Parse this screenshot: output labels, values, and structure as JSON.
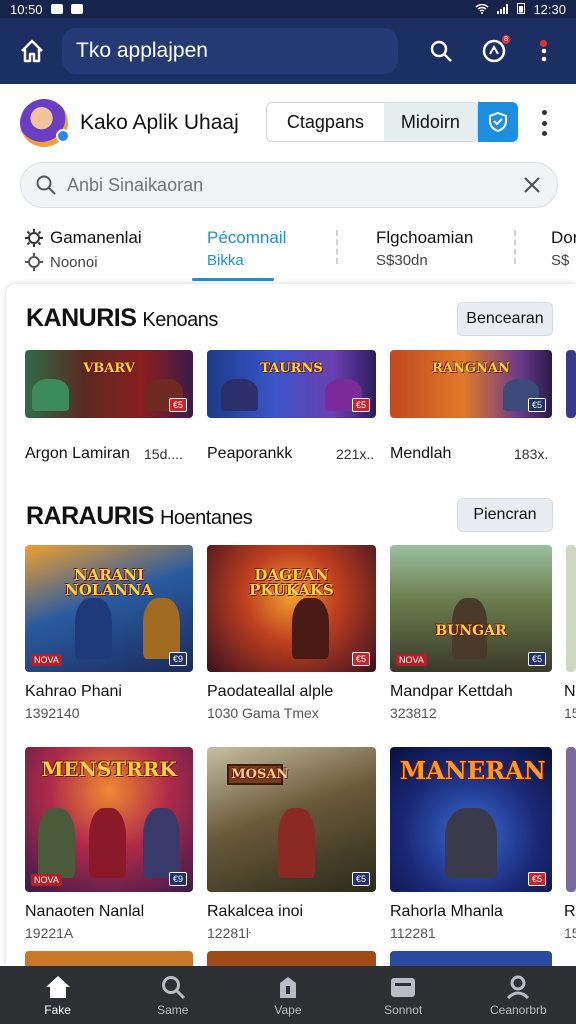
{
  "status": {
    "time_left": "10:50",
    "time_right": "12:30"
  },
  "appbar": {
    "title": "Tko applajpen",
    "notif_badge": "8"
  },
  "profile": {
    "name": "Kako Aplik Uhaaj",
    "seg_left": "Ctagpans",
    "seg_right": "Midoirn"
  },
  "search": {
    "placeholder": "Anbi Sinaikaoran"
  },
  "tabs": [
    {
      "line1": "Gamanenlai",
      "line2": "Noonoi"
    },
    {
      "line1": "Pécomnail",
      "line2": "Bikka"
    },
    {
      "line1": "Flgchoamian",
      "line2": "S$30dn"
    },
    {
      "line1": "Dor",
      "line2": "S$"
    }
  ],
  "section1": {
    "title": "KANURIS",
    "subtitle": "Kenoans",
    "button": "Bencearan",
    "items": [
      {
        "logo": "VBARV",
        "title": "Argon Lamiran",
        "value": "15d....",
        "tag": "€5"
      },
      {
        "logo": "TAURNS",
        "title": "Peaporankk",
        "value": "221x..",
        "tag": "€5"
      },
      {
        "logo": "RANGNAN",
        "title": "Mendlah",
        "value": "183x.",
        "tag": "€5"
      }
    ]
  },
  "section2": {
    "title": "RARAURIS",
    "subtitle": "Hoentanes",
    "button": "Piencran",
    "items": [
      {
        "logo": "NARANI NOLANNA",
        "title": "Kahrao Phani",
        "sub": "1392140",
        "tag": "€9"
      },
      {
        "logo": "DAGEAN PKUKAKS",
        "title": "Paodateallal alple",
        "sub": "1030 Gama Tmex",
        "tag": "€5"
      },
      {
        "logo": "BUNGAR",
        "title": "Mandpar Kettdah",
        "sub": "323812",
        "tag": "€5"
      },
      {
        "logo": "",
        "title": "N",
        "sub": "15"
      },
      {
        "logo": "MENSTRRK",
        "title": "Nanaoten Nanlal",
        "sub": "19221A",
        "tag": "€9"
      },
      {
        "logo": "MOSAN",
        "title": "Rakalcea inoi",
        "sub": "12281ŀ",
        "tag": "€5"
      },
      {
        "logo": "MANERAN",
        "title": "Rahorla Mhanla",
        "sub": "112281",
        "tag": "€5"
      },
      {
        "logo": "",
        "title": "Ri",
        "sub": "15"
      }
    ]
  },
  "bottomnav": [
    {
      "label": "Fake",
      "icon": "home-icon"
    },
    {
      "label": "Same",
      "icon": "search-icon"
    },
    {
      "label": "Vape",
      "icon": "bag-icon"
    },
    {
      "label": "Sonnot",
      "icon": "box-icon"
    },
    {
      "label": "Ceanorbrb",
      "icon": "profile-icon"
    }
  ]
}
